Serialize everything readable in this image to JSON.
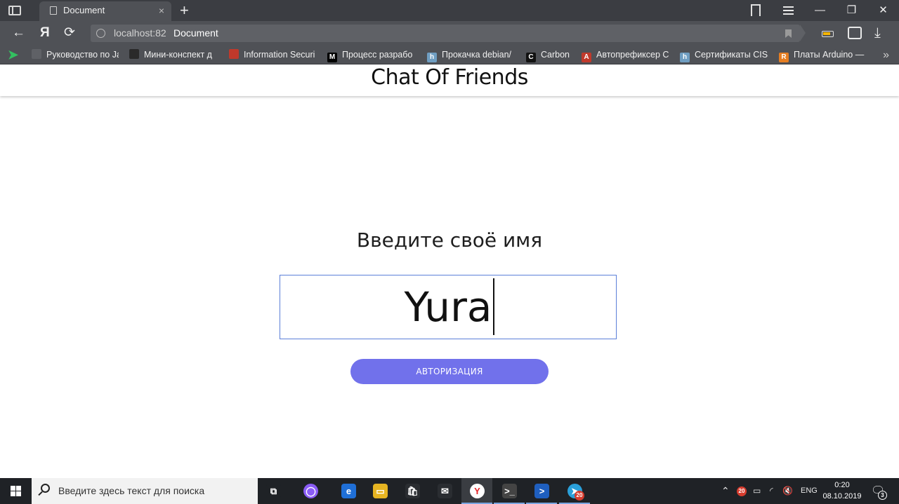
{
  "browser": {
    "tab_title": "Document",
    "tab_close": "×",
    "new_tab": "+",
    "address_host": "localhost:82",
    "address_title": "Document",
    "back": "←",
    "yandex_logo": "Я",
    "reload": "⟳",
    "download": "⤓",
    "window_controls": {
      "minimize": "—",
      "restore": "❐",
      "close": "✕"
    },
    "bookmarks": [
      {
        "label": "Руководство по Ja",
        "icon": "doc-icon",
        "color": "#5f6166"
      },
      {
        "label": "Мини-конспект д",
        "icon": "avatar-icon",
        "color": "#2a2a2a"
      },
      {
        "label": "Information Securi",
        "icon": "red-arrow-icon",
        "color": "#c0392b"
      },
      {
        "label": "Процесс разрабо",
        "icon": "medium-icon",
        "color": "#000000",
        "letter": "M"
      },
      {
        "label": "Прокачка debian/",
        "icon": "habr-icon",
        "color": "#6f9ec2",
        "letter": "h"
      },
      {
        "label": "Carbon",
        "icon": "carbon-icon",
        "color": "#111111",
        "letter": "C"
      },
      {
        "label": "Автопрефиксер С",
        "icon": "autoprefixer-icon",
        "color": "#c0392b",
        "letter": "A"
      },
      {
        "label": "Сертификаты CISS",
        "icon": "habr-icon",
        "color": "#6f9ec2",
        "letter": "h"
      },
      {
        "label": "Платы Arduino —",
        "icon": "arduino-icon",
        "color": "#e67e22",
        "letter": "R"
      }
    ],
    "bookmarks_more": "»"
  },
  "page": {
    "title": "Chat Of Friends",
    "name_label": "Введите своё имя",
    "name_value": "Yura",
    "submit_label": "АВТОРИЗАЦИЯ"
  },
  "taskbar": {
    "search_placeholder": "Введите здесь текст для поиска",
    "apps": [
      {
        "name": "task-view",
        "color": "#1f2226",
        "glyph": "⧉"
      },
      {
        "name": "alice",
        "color": "#8a5cf5",
        "glyph": "◯"
      },
      {
        "name": "edge",
        "color": "#1f6fd6",
        "glyph": "e"
      },
      {
        "name": "file-explorer",
        "color": "#e6b422",
        "glyph": "▭"
      },
      {
        "name": "store",
        "color": "#2a2d31",
        "glyph": "🛍"
      },
      {
        "name": "mail",
        "color": "#2a2d31",
        "glyph": "✉"
      },
      {
        "name": "yandex-browser",
        "color": "#ffffff",
        "glyph": "Y"
      },
      {
        "name": "terminal",
        "color": "#444444",
        "glyph": ">_"
      },
      {
        "name": "powershell",
        "color": "#1f5fbf",
        "glyph": ">"
      },
      {
        "name": "telegram",
        "color": "#2aa0da",
        "glyph": "➤"
      }
    ],
    "telegram_badge": "20",
    "tray_badge": "20",
    "language": "ENG",
    "time": "0:20",
    "date": "08.10.2019",
    "notifications_count": "3"
  }
}
